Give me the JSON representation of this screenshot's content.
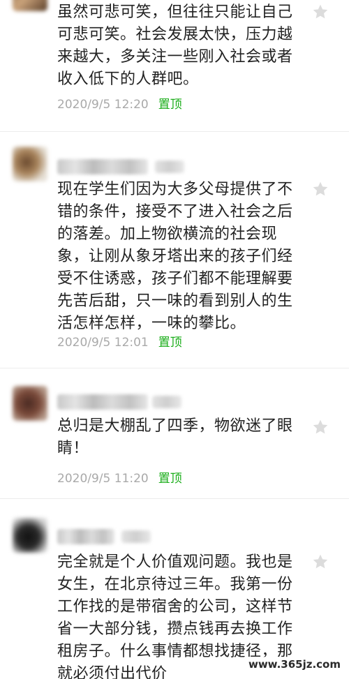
{
  "comments": [
    {
      "text": "虽然可悲可笑，但往往只能让自己可悲可笑。社会发展太快，压力越来越大，多关注一些刚入社会或者收入低下的人群吧。",
      "time": "2020/9/5 12:20",
      "pin_label": "置顶",
      "star_icon": "star-outline-icon"
    },
    {
      "text": "现在学生们因为大多父母提供了不错的条件，接受不了进入社会之后的落差。加上物欲横流的社会现象，让刚从象牙塔出来的孩子们经受不住诱惑，孩子们都不能理解要先苦后甜，只一味的看到别人的生活怎样怎样，一味的攀比。",
      "time": "2020/9/5 12:01",
      "pin_label": "置顶",
      "star_icon": "star-outline-icon"
    },
    {
      "text": "总归是大棚乱了四季，物欲迷了眼睛！",
      "time": "2020/9/5 11:20",
      "pin_label": "置顶",
      "star_icon": "star-outline-icon"
    },
    {
      "text": "完全就是个人价值观问题。我也是女生，在北京待过三年。我第一份工作找的是带宿舍的公司，这样节省一大部分钱，攒点钱再去换工作租房子。什么事情都想找捷径，那就必须付出代价",
      "star_icon": "star-outline-icon"
    }
  ],
  "watermark": "www.365jz.com",
  "colors": {
    "pin_green": "#1aad19",
    "meta_gray": "#a9a9a9",
    "text_dark": "#222222"
  }
}
